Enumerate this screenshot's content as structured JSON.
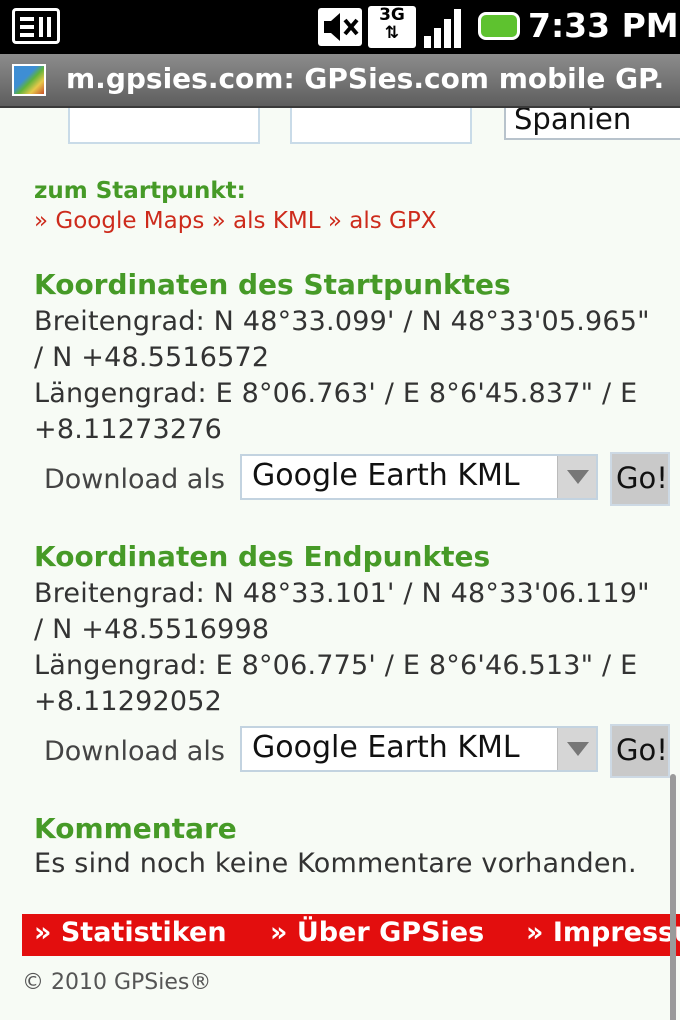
{
  "status_bar": {
    "time": "7:33 PM",
    "network": "3G",
    "icons": [
      "notification-icon",
      "mute-icon",
      "3g-icon",
      "signal-icon",
      "battery-icon"
    ]
  },
  "browser": {
    "title": "m.gpsies.com: GPSies.com mobile GP..."
  },
  "form_top": {
    "country_value": "Spanien"
  },
  "start_links": {
    "label": "zum Startpunkt:",
    "marker": "»",
    "links": [
      "Google Maps",
      "als KML",
      "als GPX"
    ]
  },
  "start": {
    "heading": "Koordinaten des Startpunktes",
    "lat_line1": "Breitengrad: N 48°33.099' / N 48°33'05.965\"",
    "lat_line2": "/ N +48.5516572",
    "lon_line1": "Längengrad: E 8°06.763' / E 8°6'45.837\" / E",
    "lon_line2": "+8.11273276",
    "download_label": "Download als",
    "download_value": "Google Earth KML",
    "go_label": "Go!"
  },
  "end": {
    "heading": "Koordinaten des Endpunktes",
    "lat_line1": "Breitengrad: N 48°33.101' / N 48°33'06.119\"",
    "lat_line2": "/ N +48.5516998",
    "lon_line1": "Längengrad: E 8°06.775' / E 8°6'46.513\" / E",
    "lon_line2": "+8.11292052",
    "download_label": "Download als",
    "download_value": "Google Earth KML",
    "go_label": "Go!"
  },
  "comments": {
    "heading": "Kommentare",
    "text": "Es sind noch keine Kommentare vorhanden."
  },
  "footer_nav": {
    "items": [
      "» Statistiken",
      "» Über GPSies",
      "» Impressum"
    ]
  },
  "copyright": "© 2010 GPSies®",
  "colors": {
    "heading_green": "#469a27",
    "link_red": "#cd2b1c",
    "footer_red": "#e30e0e"
  }
}
